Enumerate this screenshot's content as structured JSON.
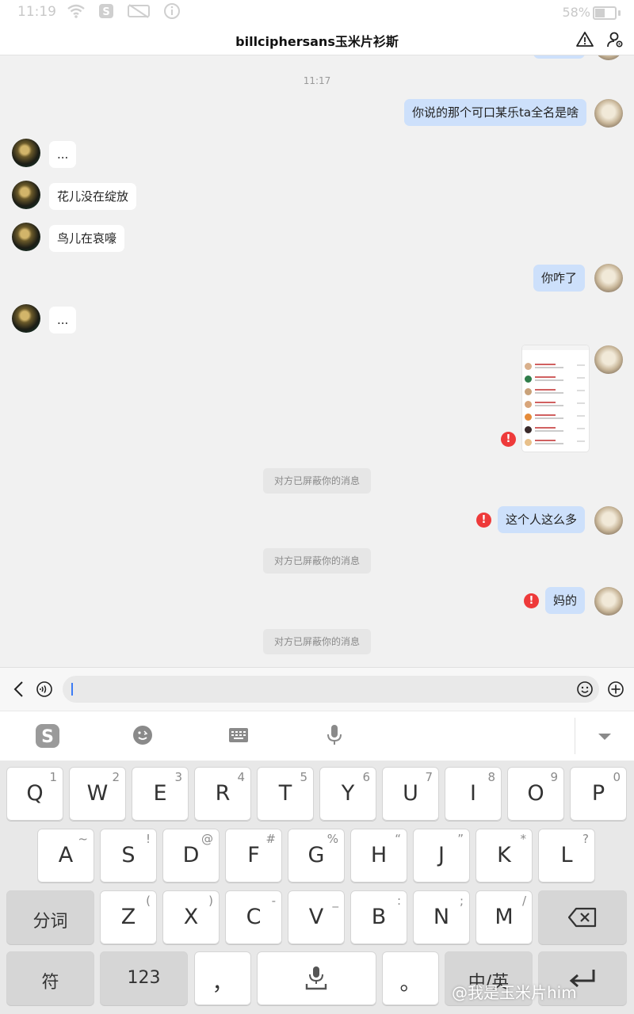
{
  "status_bar": {
    "time": "11:19",
    "battery": "58%"
  },
  "header": {
    "title": "billciphersans玉米片衫斯"
  },
  "chat": {
    "timestamp": "11:17",
    "messages": [
      {
        "text": "你说的那个可口某乐ta全名是啥"
      },
      {
        "text": "..."
      },
      {
        "text": "花儿没在绽放"
      },
      {
        "text": "鸟儿在哀嚎"
      },
      {
        "text": "你咋了"
      },
      {
        "text": "..."
      },
      {
        "text": "这个人这么多"
      },
      {
        "text": "妈的"
      }
    ],
    "blocked_notice": "对方已屏蔽你的消息",
    "error_mark": "!"
  },
  "input": {
    "value": ""
  },
  "keyboard": {
    "row1": [
      {
        "main": "Q",
        "sub": "1"
      },
      {
        "main": "W",
        "sub": "2"
      },
      {
        "main": "E",
        "sub": "3"
      },
      {
        "main": "R",
        "sub": "4"
      },
      {
        "main": "T",
        "sub": "5"
      },
      {
        "main": "Y",
        "sub": "6"
      },
      {
        "main": "U",
        "sub": "7"
      },
      {
        "main": "I",
        "sub": "8"
      },
      {
        "main": "O",
        "sub": "9"
      },
      {
        "main": "P",
        "sub": "0"
      }
    ],
    "row2": [
      {
        "main": "A",
        "sub": "~"
      },
      {
        "main": "S",
        "sub": "!"
      },
      {
        "main": "D",
        "sub": "@"
      },
      {
        "main": "F",
        "sub": "#"
      },
      {
        "main": "G",
        "sub": "%"
      },
      {
        "main": "H",
        "sub": "“"
      },
      {
        "main": "J",
        "sub": "”"
      },
      {
        "main": "K",
        "sub": "*"
      },
      {
        "main": "L",
        "sub": "?"
      }
    ],
    "row3": [
      {
        "main": "Z",
        "sub": "("
      },
      {
        "main": "X",
        "sub": ")"
      },
      {
        "main": "C",
        "sub": "-"
      },
      {
        "main": "V",
        "sub": "_"
      },
      {
        "main": "B",
        "sub": ":"
      },
      {
        "main": "N",
        "sub": ";"
      },
      {
        "main": "M",
        "sub": "/"
      }
    ],
    "segment_label": "分词",
    "symbol_label": "符",
    "numbers_label": "123",
    "comma": "，",
    "period": "。",
    "lang_label": "中/英"
  },
  "watermark": "@我是玉米片him",
  "colors": {
    "accent": "#3d7cf5",
    "self_bubble": "#cde0fb",
    "error": "#ee3a3a"
  }
}
